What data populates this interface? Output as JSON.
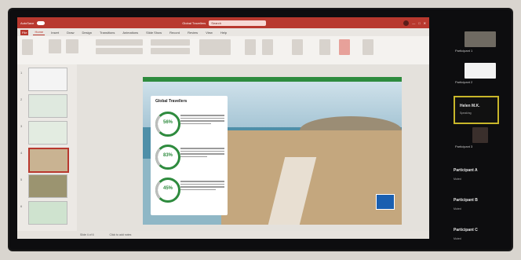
{
  "window": {
    "title_left": "AutoSave",
    "doc_title": "Global Travellers",
    "search_placeholder": "Search"
  },
  "ribbon_tabs": [
    "File",
    "Home",
    "Insert",
    "Draw",
    "Design",
    "Transitions",
    "Animations",
    "Slide Show",
    "Record",
    "Review",
    "View",
    "Help"
  ],
  "slide": {
    "title": "Global Travellers",
    "stats": [
      {
        "percent": "56%",
        "value": 0.56
      },
      {
        "percent": "83%",
        "value": 0.83
      },
      {
        "percent": "45%",
        "value": 0.45
      }
    ]
  },
  "thumbnails": [
    "1",
    "2",
    "3",
    "4",
    "5",
    "6"
  ],
  "status": {
    "left": "Slide 4 of 6",
    "notes": "Click to add notes"
  },
  "participants": [
    {
      "name": "Participant 1"
    },
    {
      "name": "Participant 2"
    },
    {
      "name": "Participant 3"
    }
  ],
  "highlight": {
    "name": "Helen M.K.",
    "sub": "Speaking"
  },
  "tiles": [
    {
      "name": "Participant A",
      "sub": "Muted"
    },
    {
      "name": "Participant B",
      "sub": "Muted"
    },
    {
      "name": "Participant C",
      "sub": "Muted"
    }
  ]
}
